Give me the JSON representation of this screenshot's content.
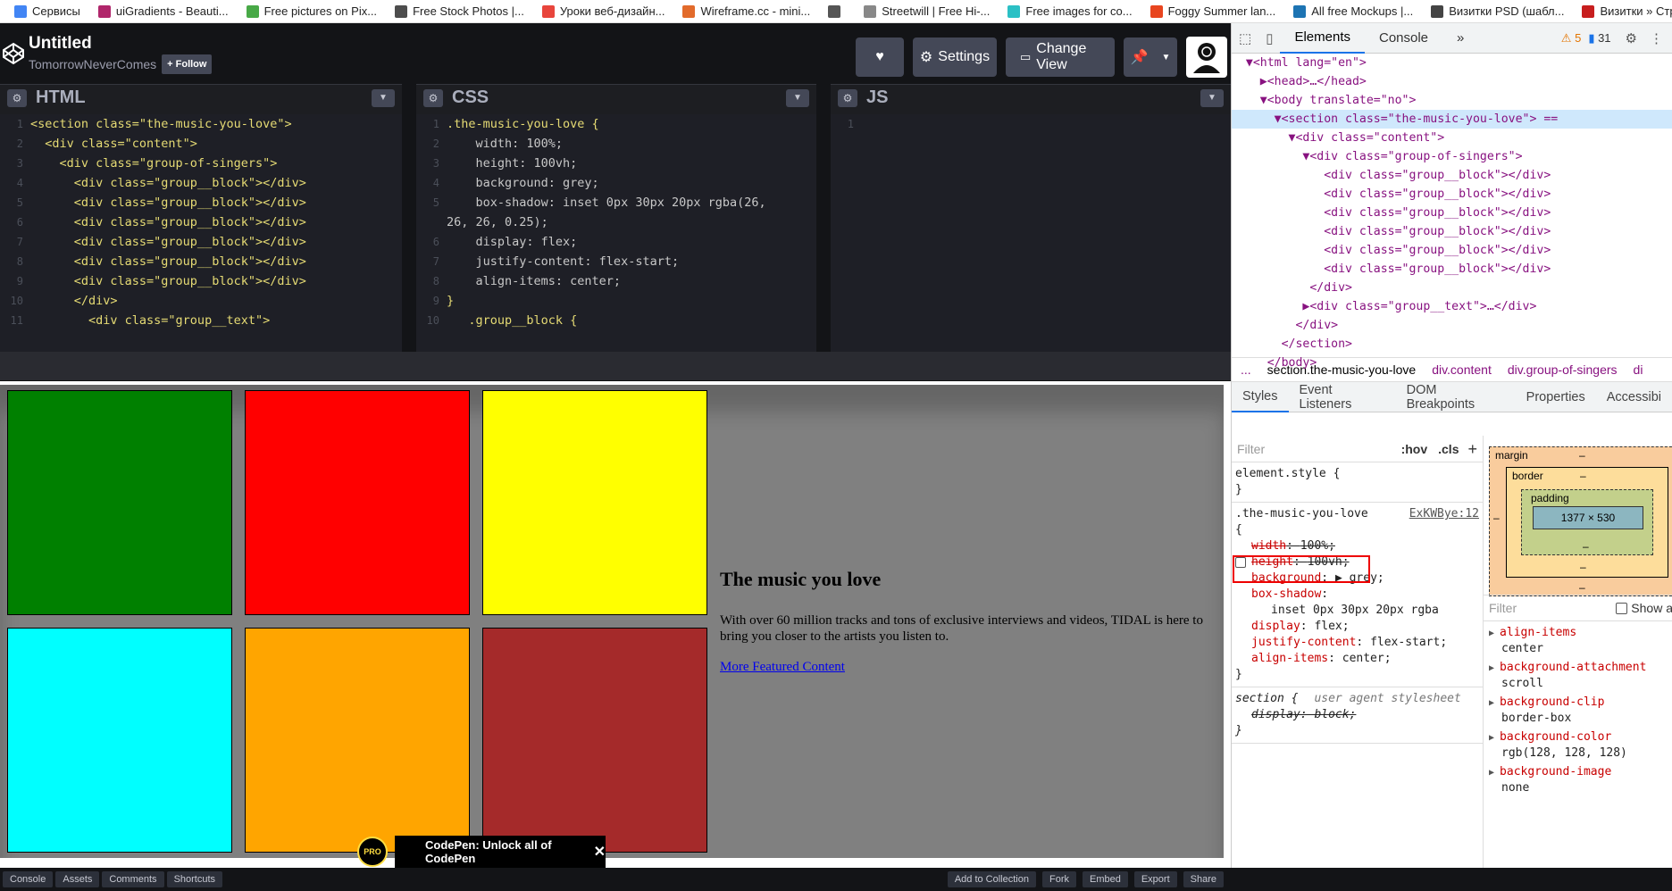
{
  "bookmarks": [
    {
      "label": "Сервисы",
      "color": "#4285f4"
    },
    {
      "label": "uiGradients - Beauti...",
      "color": "#b0266b"
    },
    {
      "label": "Free pictures on Pix...",
      "color": "#48a947"
    },
    {
      "label": "Free Stock Photos |...",
      "color": "#4d4d4d"
    },
    {
      "label": "Уроки веб-дизайн...",
      "color": "#e8453c"
    },
    {
      "label": "Wireframe.cc - mini...",
      "color": "#e26b2b"
    },
    {
      "label": "",
      "color": "#555555"
    },
    {
      "label": "Streetwill | Free Hi-...",
      "color": "#888888"
    },
    {
      "label": "Free images for co...",
      "color": "#2bc0c5"
    },
    {
      "label": "Foggy Summer lan...",
      "color": "#e8451f"
    },
    {
      "label": "All free Mockups |...",
      "color": "#1d74b3"
    },
    {
      "label": "Визитки PSD (шабл...",
      "color": "#444444"
    },
    {
      "label": "Визитки » Страниц...",
      "color": "#c71e1e"
    }
  ],
  "codepen": {
    "title": "Untitled",
    "author": "TomorrowNeverComes",
    "follow": "+ Follow",
    "settings": "Settings",
    "change_view": "Change View"
  },
  "editors": {
    "html_title": "HTML",
    "css_title": "CSS",
    "js_title": "JS",
    "html_lines": [
      "<section class=\"the-music-you-love\">",
      "  <div class=\"content\">",
      "    <div class=\"group-of-singers\">",
      "      <div class=\"group__block\"></div>",
      "      <div class=\"group__block\"></div>",
      "      <div class=\"group__block\"></div>",
      "      <div class=\"group__block\"></div>",
      "      <div class=\"group__block\"></div>",
      "      <div class=\"group__block\"></div>",
      "      </div>",
      "        <div class=\"group__text\">"
    ],
    "css_lines": [
      ".the-music-you-love {",
      "    width: 100%;",
      "    height: 100vh;",
      "    background: grey;",
      "    box-shadow: inset 0px 30px 20px rgba(26,",
      "26, 26, 0.25);",
      "    display: flex;",
      "    justify-content: flex-start;",
      "    align-items: center;",
      "}",
      "   .group__block {"
    ],
    "css_line_numbers": [
      "1",
      "2",
      "3",
      "4",
      "5",
      "",
      "6",
      "7",
      "8",
      "9",
      "10"
    ],
    "js_lines": [
      "1"
    ]
  },
  "preview": {
    "block_colors": [
      "#008000",
      "#ff0000",
      "#ffff00",
      "#00ffff",
      "#ffa500",
      "#a52a2a"
    ],
    "heading": "The music you love",
    "paragraph": "With over 60 million tracks and tons of exclusive interviews and videos, TIDAL is here to bring you closer to the artists you listen to.",
    "link": "More Featured Content"
  },
  "footer": {
    "left": [
      "Console",
      "Assets",
      "Comments",
      "Shortcuts"
    ],
    "right": [
      "Add to Collection",
      "Fork",
      "Embed",
      "Export",
      "Share"
    ],
    "promo_badge": "PRO",
    "promo_text": "CodePen: Unlock all of CodePen",
    "promo_close": "✕"
  },
  "devtools": {
    "tabs": [
      "Elements",
      "Console",
      "»"
    ],
    "warnings": "5",
    "messages": "31",
    "dom_lines": [
      "  ▼<html lang=\"en\">",
      "    ▶<head>…</head>",
      "    ▼<body translate=\"no\">",
      "      ▼<section class=\"the-music-you-love\"> ==",
      "        ▼<div class=\"content\">",
      "          ▼<div class=\"group-of-singers\">",
      "             <div class=\"group__block\"></div>",
      "             <div class=\"group__block\"></div>",
      "             <div class=\"group__block\"></div>",
      "             <div class=\"group__block\"></div>",
      "             <div class=\"group__block\"></div>",
      "             <div class=\"group__block\"></div>",
      "           </div>",
      "          ▶<div class=\"group__text\">…</div>",
      "         </div>",
      "       </section>",
      "     </body>"
    ],
    "crumbs": [
      "...",
      "section.the-music-you-love",
      "div.content",
      "div.group-of-singers",
      "di"
    ],
    "subtabs": [
      "Styles",
      "Event Listeners",
      "DOM Breakpoints",
      "Properties",
      "Accessibi"
    ],
    "filter_placeholder": "Filter",
    "hov": ":hov",
    "cls": ".cls",
    "element_style": "element.style {",
    "rule_selector": ".the-music-you-love",
    "rule_source": "ExKWBye:12",
    "rule_lines": [
      {
        "name": "width",
        "value": "100%;",
        "struck": true
      },
      {
        "name": "height",
        "value": "100vh;",
        "struck": true
      },
      {
        "name": "background",
        "value": "▶ grey;",
        "struck": false
      },
      {
        "name": "box-shadow",
        "value": "",
        "struck": false
      },
      {
        "name": "",
        "value": "inset 0px 30px 20px rgba",
        "struck": false
      },
      {
        "name": "display",
        "value": "flex;",
        "struck": false
      },
      {
        "name": "justify-content",
        "value": "flex-start;",
        "struck": false
      },
      {
        "name": "align-items",
        "value": "center;",
        "struck": false
      }
    ],
    "ua_selector": "section {",
    "ua_source": "user agent stylesheet",
    "ua_line": "display: block;",
    "boxmodel": {
      "margin": "margin",
      "border": "border",
      "padding": "padding",
      "content": "1377 × 530",
      "dash": "–"
    },
    "computed_filter": "Filter",
    "show_all": "Show a",
    "computed": [
      {
        "name": "align-items",
        "value": "center"
      },
      {
        "name": "background-attachment",
        "value": "scroll"
      },
      {
        "name": "background-clip",
        "value": "border-box"
      },
      {
        "name": "background-color",
        "value": "rgb(128, 128, 128)"
      },
      {
        "name": "background-image",
        "value": "none"
      }
    ]
  }
}
